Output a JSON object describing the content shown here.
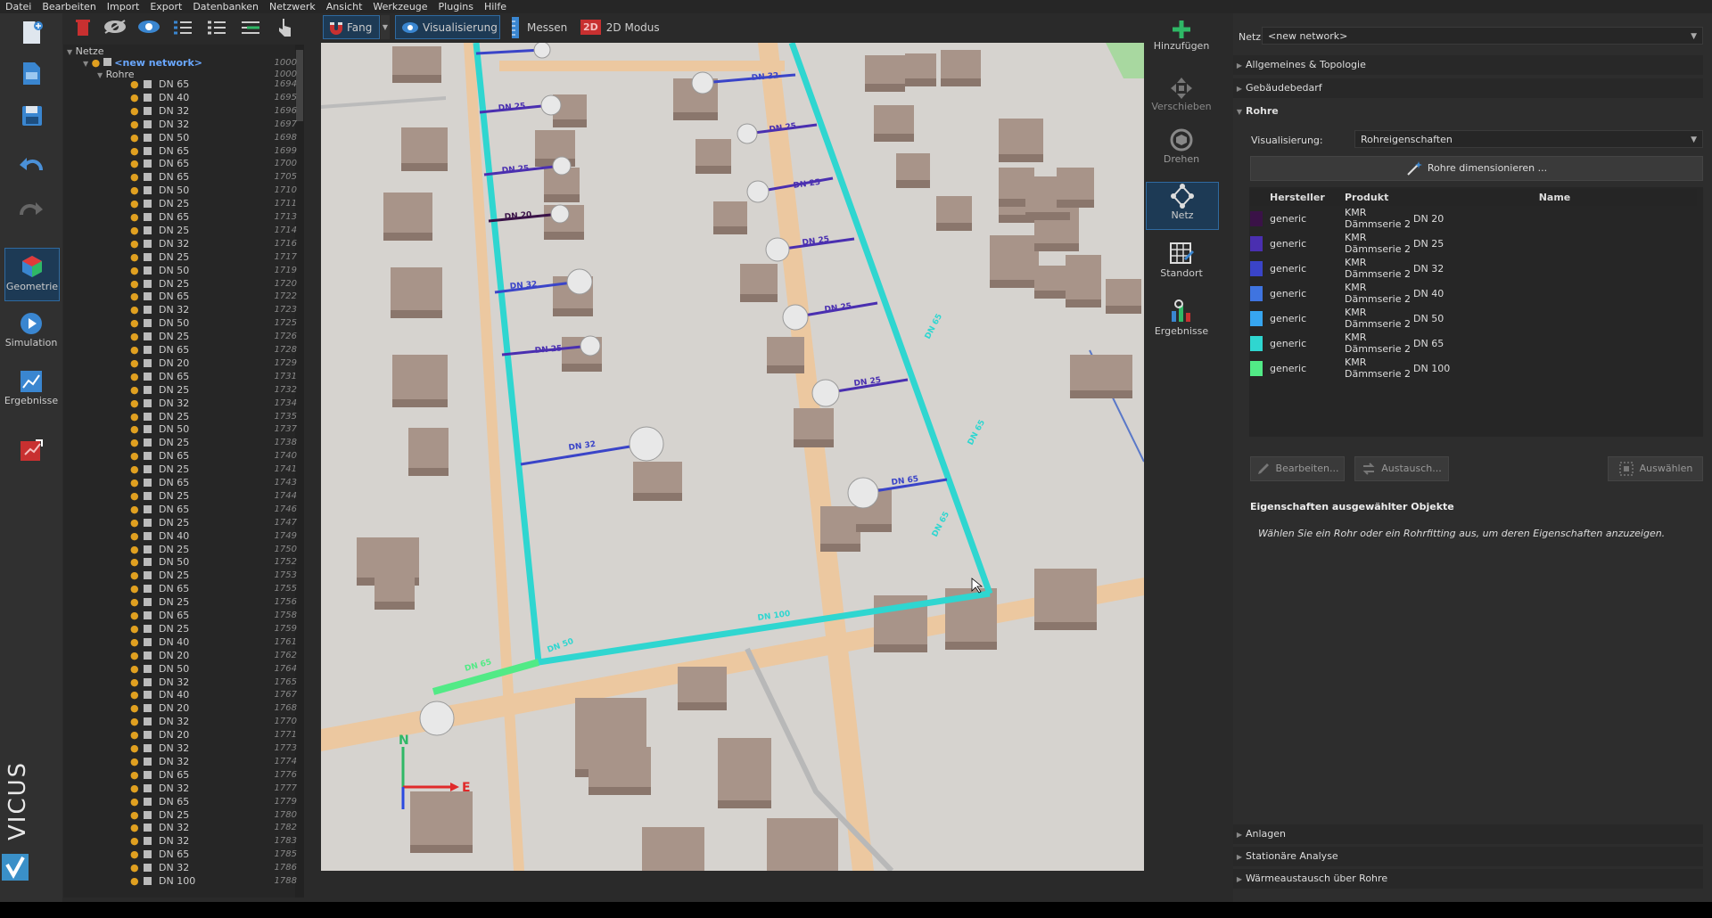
{
  "menu": [
    "Datei",
    "Bearbeiten",
    "Import",
    "Export",
    "Datenbanken",
    "Netzwerk",
    "Ansicht",
    "Werkzeuge",
    "Plugins",
    "Hilfe"
  ],
  "toolbar": {
    "fang": "Fang",
    "visualisierung": "Visualisierung",
    "messen": "Messen",
    "modus_badge": "2D",
    "modus": "2D Modus"
  },
  "left_modes": {
    "geometrie": "Geometrie",
    "simulation": "Simulation",
    "ergebnisse": "Ergebnisse",
    "brand": "VICUS"
  },
  "tree": {
    "root": "Netze",
    "network": "<new network>",
    "network_id": "1000",
    "group": "Rohre",
    "group_id": "1000",
    "rows": [
      [
        "DN 65",
        "1694"
      ],
      [
        "DN 40",
        "1695"
      ],
      [
        "DN 32",
        "1696"
      ],
      [
        "DN 32",
        "1697"
      ],
      [
        "DN 50",
        "1698"
      ],
      [
        "DN 65",
        "1699"
      ],
      [
        "DN 65",
        "1700"
      ],
      [
        "DN 65",
        "1705"
      ],
      [
        "DN 50",
        "1710"
      ],
      [
        "DN 25",
        "1711"
      ],
      [
        "DN 65",
        "1713"
      ],
      [
        "DN 25",
        "1714"
      ],
      [
        "DN 32",
        "1716"
      ],
      [
        "DN 25",
        "1717"
      ],
      [
        "DN 50",
        "1719"
      ],
      [
        "DN 25",
        "1720"
      ],
      [
        "DN 65",
        "1722"
      ],
      [
        "DN 32",
        "1723"
      ],
      [
        "DN 50",
        "1725"
      ],
      [
        "DN 25",
        "1726"
      ],
      [
        "DN 65",
        "1728"
      ],
      [
        "DN 20",
        "1729"
      ],
      [
        "DN 65",
        "1731"
      ],
      [
        "DN 25",
        "1732"
      ],
      [
        "DN 32",
        "1734"
      ],
      [
        "DN 25",
        "1735"
      ],
      [
        "DN 50",
        "1737"
      ],
      [
        "DN 25",
        "1738"
      ],
      [
        "DN 65",
        "1740"
      ],
      [
        "DN 25",
        "1741"
      ],
      [
        "DN 65",
        "1743"
      ],
      [
        "DN 25",
        "1744"
      ],
      [
        "DN 65",
        "1746"
      ],
      [
        "DN 25",
        "1747"
      ],
      [
        "DN 40",
        "1749"
      ],
      [
        "DN 25",
        "1750"
      ],
      [
        "DN 50",
        "1752"
      ],
      [
        "DN 25",
        "1753"
      ],
      [
        "DN 65",
        "1755"
      ],
      [
        "DN 25",
        "1756"
      ],
      [
        "DN 65",
        "1758"
      ],
      [
        "DN 25",
        "1759"
      ],
      [
        "DN 40",
        "1761"
      ],
      [
        "DN 20",
        "1762"
      ],
      [
        "DN 50",
        "1764"
      ],
      [
        "DN 32",
        "1765"
      ],
      [
        "DN 40",
        "1767"
      ],
      [
        "DN 20",
        "1768"
      ],
      [
        "DN 32",
        "1770"
      ],
      [
        "DN 20",
        "1771"
      ],
      [
        "DN 32",
        "1773"
      ],
      [
        "DN 32",
        "1774"
      ],
      [
        "DN 65",
        "1776"
      ],
      [
        "DN 32",
        "1777"
      ],
      [
        "DN 65",
        "1779"
      ],
      [
        "DN 25",
        "1780"
      ],
      [
        "DN 32",
        "1782"
      ],
      [
        "DN 32",
        "1783"
      ],
      [
        "DN 65",
        "1785"
      ],
      [
        "DN 32",
        "1786"
      ],
      [
        "DN 100",
        "1788"
      ]
    ]
  },
  "viewport": {
    "pipe_labels": [
      "DN 25",
      "DN 25",
      "DN 20",
      "DN 32",
      "DN 25",
      "DN 32",
      "DN 25",
      "DN 25",
      "DN 25",
      "DN 25",
      "DN 25",
      "DN 32",
      "DN 65",
      "DN 100",
      "DN 65",
      "DN 50",
      "DN 65",
      "DN 65",
      "DN 65"
    ],
    "axis_n": "N",
    "axis_e": "E"
  },
  "right_tools": {
    "hinzufuegen": "Hinzufügen",
    "verschieben": "Verschieben",
    "drehen": "Drehen",
    "netz": "Netz",
    "standort": "Standort",
    "ergebnisse": "Ergebnisse"
  },
  "props": {
    "netz_label": "Netz:",
    "netz_value": "<new network>",
    "sections_top": [
      "Allgemeines & Topologie",
      "Gebäudebedarf"
    ],
    "rohre_title": "Rohre",
    "vis_label": "Visualisierung:",
    "vis_value": "Rohreigenschaften",
    "dimension_btn": "Rohre dimensionieren ...",
    "table_headers": [
      "Hersteller",
      "Produkt",
      "Name"
    ],
    "table_rows": [
      {
        "color": "#3a1247",
        "hersteller": "generic",
        "produkt": "KMR Dämmserie 2",
        "name": "DN 20"
      },
      {
        "color": "#4a2fb0",
        "hersteller": "generic",
        "produkt": "KMR Dämmserie 2",
        "name": "DN 25"
      },
      {
        "color": "#3a44c8",
        "hersteller": "generic",
        "produkt": "KMR Dämmserie 2",
        "name": "DN 32"
      },
      {
        "color": "#3f74e0",
        "hersteller": "generic",
        "produkt": "KMR Dämmserie 2",
        "name": "DN 40"
      },
      {
        "color": "#37a6f0",
        "hersteller": "generic",
        "produkt": "KMR Dämmserie 2",
        "name": "DN 50"
      },
      {
        "color": "#2fd6d0",
        "hersteller": "generic",
        "produkt": "KMR Dämmserie 2",
        "name": "DN 65"
      },
      {
        "color": "#52ea86",
        "hersteller": "generic",
        "produkt": "KMR Dämmserie 2",
        "name": "DN 100"
      }
    ],
    "btn_edit": "Bearbeiten...",
    "btn_swap": "Austausch...",
    "btn_select": "Auswählen",
    "sel_title": "Eigenschaften ausgewählter Objekte",
    "sel_hint": "Wählen Sie ein Rohr oder ein Rohrfitting aus, um deren Eigenschaften anzuzeigen.",
    "sections_bottom": [
      "Anlagen",
      "Stationäre Analyse",
      "Wärmeaustausch über Rohre"
    ]
  }
}
